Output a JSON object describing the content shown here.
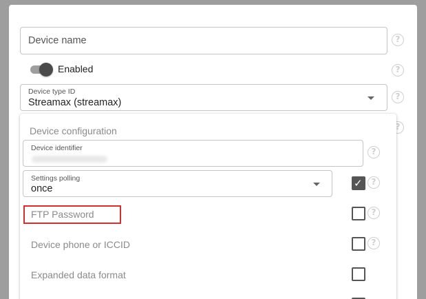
{
  "form": {
    "device_name": {
      "placeholder": "Device name"
    },
    "enabled": {
      "label": "Enabled",
      "checked": true
    },
    "device_type": {
      "label": "Device type ID",
      "value": "Streamax (streamax)"
    }
  },
  "config": {
    "title": "Device configuration",
    "identifier": {
      "label": "Device identifier"
    },
    "settings_polling": {
      "label": "Settings polling",
      "value": "once",
      "checked": true
    },
    "ftp_password": {
      "placeholder": "FTP Password",
      "checked": false
    },
    "phone": {
      "label": "Device phone or ICCID",
      "checked": false
    },
    "expanded_format": {
      "label": "Expanded data format",
      "checked": false
    }
  },
  "icons": {
    "help": "?",
    "check": "✓"
  },
  "colors": {
    "highlight_border": "#d32f2f",
    "toggle_thumb": "#4a4a4a",
    "toggle_track": "#9e9e9e"
  }
}
